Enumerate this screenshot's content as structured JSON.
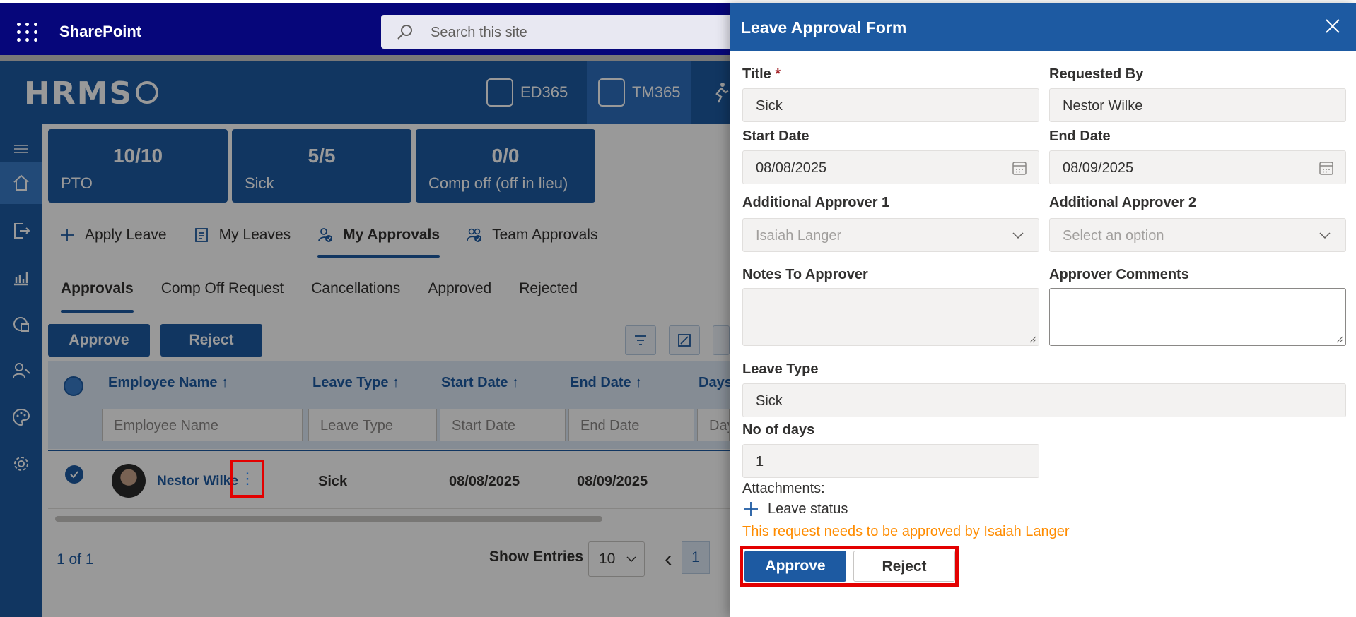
{
  "suite": {
    "app_name": "SharePoint",
    "search_placeholder": "Search this site"
  },
  "hrms": {
    "logo": "HRMS",
    "apps": [
      {
        "label": "ED365"
      },
      {
        "label": "TM365"
      }
    ]
  },
  "cards": [
    {
      "value": "10/10",
      "label": "PTO"
    },
    {
      "value": "5/5",
      "label": "Sick"
    },
    {
      "value": "0/0",
      "label": "Comp off (off in lieu)"
    }
  ],
  "action_tabs": [
    {
      "label": "Apply Leave",
      "icon": "plus-icon"
    },
    {
      "label": "My Leaves",
      "icon": "list-icon"
    },
    {
      "label": "My Approvals",
      "icon": "approver-icon",
      "active": true
    },
    {
      "label": "Team Approvals",
      "icon": "team-approver-icon"
    }
  ],
  "sub_tabs": [
    "Approvals",
    "Comp Off Request",
    "Cancellations",
    "Approved",
    "Rejected"
  ],
  "toolbar": {
    "approve": "Approve",
    "reject": "Reject"
  },
  "table": {
    "headers": [
      "Employee Name ↑",
      "Leave Type ↑",
      "Start Date ↑",
      "End Date ↑",
      "Days"
    ],
    "filters": [
      "Employee Name",
      "Leave Type",
      "Start Date",
      "End Date",
      "Day"
    ],
    "row": {
      "employee": "Nestor Wilke",
      "more": "⋮",
      "leave_type": "Sick",
      "start": "08/08/2025",
      "end": "08/09/2025"
    }
  },
  "pager": {
    "info": "1 of 1",
    "show_entries": "Show Entries",
    "entries": "10",
    "page": "1",
    "prev": "‹",
    "next": "›"
  },
  "panel": {
    "title": "Leave Approval Form",
    "title_label": "Title",
    "required_mark": "*",
    "title_value": "Sick",
    "requested_by_label": "Requested By",
    "requested_by_value": "Nestor Wilke",
    "start_label": "Start Date",
    "start_value": "08/08/2025",
    "end_label": "End Date",
    "end_value": "08/09/2025",
    "approver1_label": "Additional Approver 1",
    "approver1_value": "Isaiah Langer",
    "approver2_label": "Additional Approver 2",
    "approver2_placeholder": "Select an option",
    "notes_label": "Notes To Approver",
    "comments_label": "Approver Comments",
    "leave_type_label": "Leave Type",
    "leave_type_value": "Sick",
    "days_label": "No of days",
    "days_value": "1",
    "attachments_label": "Attachments:",
    "leave_status_label": "Leave status",
    "warning": "This request needs to be approved by Isaiah Langer",
    "approve": "Approve",
    "reject": "Reject"
  },
  "colors": {
    "brand": "#1d5aa2",
    "suite": "#06067a",
    "warning": "#ff8c00",
    "highlight": "#e30000"
  }
}
